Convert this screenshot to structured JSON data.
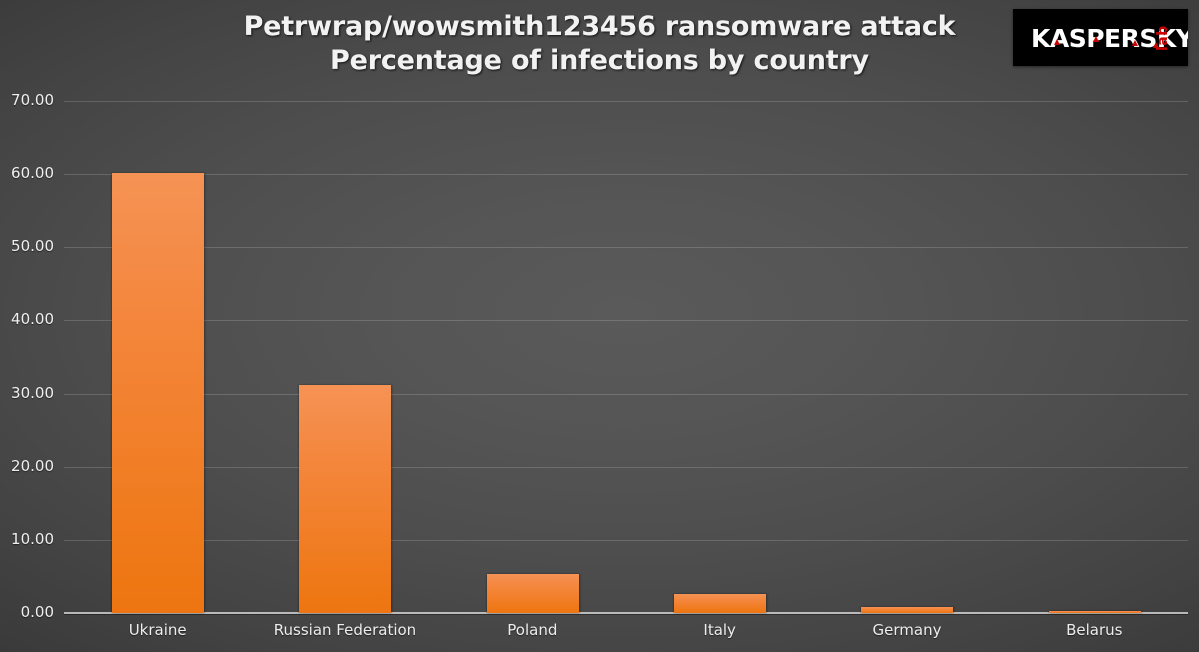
{
  "chart_data": {
    "type": "bar",
    "title": "Petrwrap/wowsmith123456 ransomware attack",
    "subtitle": "Percentage of infections by country",
    "xlabel": "",
    "ylabel": "",
    "categories": [
      "Ukraine",
      "Russian Federation",
      "Poland",
      "Italy",
      "Germany",
      "Belarus"
    ],
    "values": [
      60.13,
      31.11,
      5.35,
      2.54,
      0.82,
      0.21
    ],
    "ylim": [
      0,
      70
    ],
    "ytick_values": [
      0,
      10,
      20,
      30,
      40,
      50,
      60,
      70
    ],
    "ytick_labels": [
      "0.00",
      "10.00",
      "20.00",
      "30.00",
      "40.00",
      "50.00",
      "60.00",
      "70.00"
    ],
    "grid": true,
    "legend": false,
    "bar_color": "#f1802c",
    "bar_color_top": "#f59355",
    "bar_color_bottom": "#ee7511",
    "background_color": "#4d4d4d",
    "text_color": "#f0f0f0"
  },
  "title": {
    "line1": "Petrwrap/wowsmith123456 ransomware attack",
    "line2": "Percentage of infections by country"
  },
  "logo": {
    "brand": "KASPERSKY",
    "suffix": "lab",
    "background_color": "#000000",
    "text_color": "#ffffff",
    "accent_color": "#cc0000"
  }
}
